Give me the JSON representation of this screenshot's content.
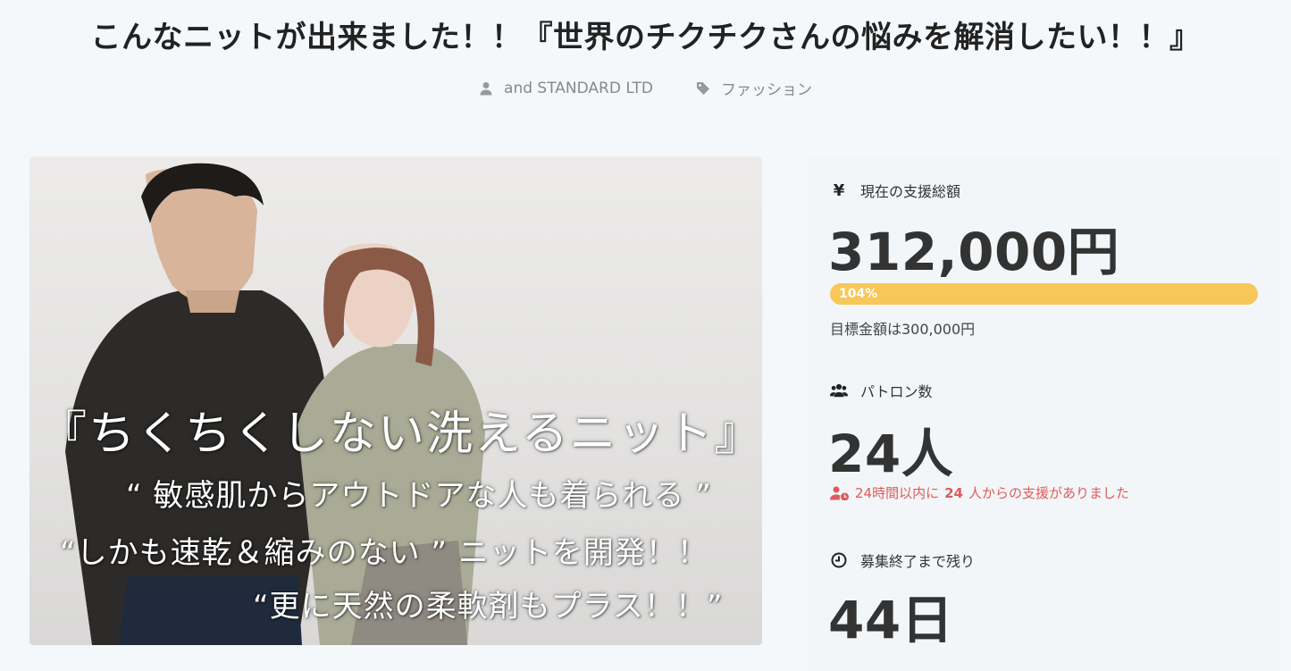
{
  "title": "こんなニットが出来ました！！『世界のチクチクさんの悩みを解消したい！！』",
  "meta": {
    "author": "and STANDARD LTD",
    "category": "ファッション"
  },
  "hero": {
    "line1": "『ちくちくしない洗えるニット』",
    "line2": "“ 敏感肌からアウトドアな人も着られる ”",
    "line3": "“しかも速乾＆縮みのない ” ニットを開発！！",
    "line4": "“更に天然の柔軟剤もプラス！！”"
  },
  "stats": {
    "funding_label": "現在の支援総額",
    "funding_amount": "312,000円",
    "progress_percent": 104,
    "progress_label": "104%",
    "goal_text": "目標金額は300,000円",
    "patrons_label": "パトロン数",
    "patrons_value": "24人",
    "recent_prefix": "24時間以内に",
    "recent_count": "24",
    "recent_suffix": "人からの支援がありました",
    "remaining_label": "募集終了まで残り",
    "remaining_value": "44日"
  },
  "icons": {
    "yen": "¥",
    "author": "user-icon",
    "category": "tag-icon",
    "patrons": "users-icon",
    "recent": "user-clock-icon",
    "remaining": "clock-icon"
  },
  "colors": {
    "progress": "#f7c75a",
    "recent": "#e05a5a",
    "background": "#f5f8fa"
  }
}
